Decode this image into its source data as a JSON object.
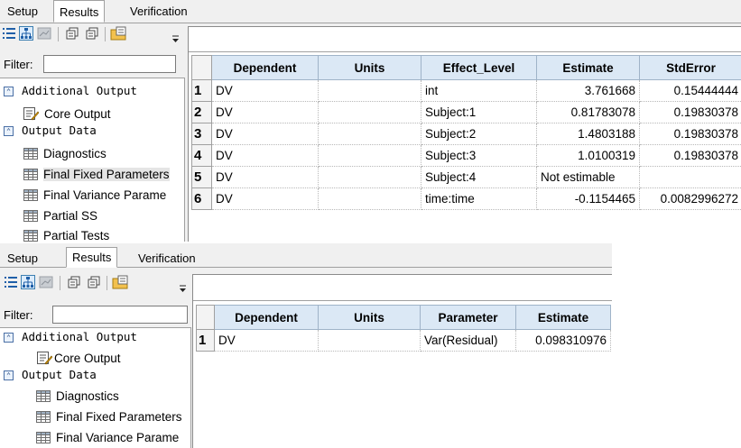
{
  "panel1": {
    "tabs": [
      "Setup",
      "Results",
      "Verification"
    ],
    "filter_label": "Filter:",
    "tree": {
      "group1": "Additional Output",
      "core_output": "Core Output",
      "group2": "Output Data",
      "leaves": [
        "Diagnostics",
        "Final Fixed Parameters",
        "Final Variance Parame",
        "Partial SS",
        "Partial Tests"
      ]
    },
    "table": {
      "headers": [
        "Dependent",
        "Units",
        "Effect_Level",
        "Estimate",
        "StdError"
      ],
      "rows": [
        {
          "n": "1",
          "dep": "DV",
          "units": "",
          "effect": "int",
          "estimate": "3.761668",
          "stderr": "0.15444444"
        },
        {
          "n": "2",
          "dep": "DV",
          "units": "",
          "effect": "Subject:1",
          "estimate": "0.81783078",
          "stderr": "0.19830378"
        },
        {
          "n": "3",
          "dep": "DV",
          "units": "",
          "effect": "Subject:2",
          "estimate": "1.4803188",
          "stderr": "0.19830378"
        },
        {
          "n": "4",
          "dep": "DV",
          "units": "",
          "effect": "Subject:3",
          "estimate": "1.0100319",
          "stderr": "0.19830378"
        },
        {
          "n": "5",
          "dep": "DV",
          "units": "",
          "effect": "Subject:4",
          "estimate": "Not estimable",
          "stderr": ""
        },
        {
          "n": "6",
          "dep": "DV",
          "units": "",
          "effect": "time:time",
          "estimate": "-0.1154465",
          "stderr": "0.0082996272"
        }
      ]
    }
  },
  "panel2": {
    "tabs": [
      "Setup",
      "Results",
      "Verification"
    ],
    "filter_label": "Filter:",
    "tree": {
      "group1": "Additional Output",
      "core_output": "Core Output",
      "group2": "Output Data",
      "leaves": [
        "Diagnostics",
        "Final Fixed Parameters",
        "Final Variance Parame"
      ]
    },
    "table": {
      "headers": [
        "Dependent",
        "Units",
        "Parameter",
        "Estimate"
      ],
      "rows": [
        {
          "n": "1",
          "dep": "DV",
          "units": "",
          "param": "Var(Residual)",
          "estimate": "0.098310976"
        }
      ]
    }
  },
  "icons": {
    "toolbar": [
      "list-view-icon",
      "tree-view-icon",
      "chart-icon",
      "copy-icon",
      "copy-all-icon",
      "export-icon",
      "overflow-icon"
    ],
    "tree_group": "collapse-icon",
    "core_output": "text-output-icon",
    "leaf": "table-icon"
  },
  "colors": {
    "header_bg": "#dbe8f5",
    "selection": "#3399ff",
    "panel_bg": "#f0f0f0"
  }
}
